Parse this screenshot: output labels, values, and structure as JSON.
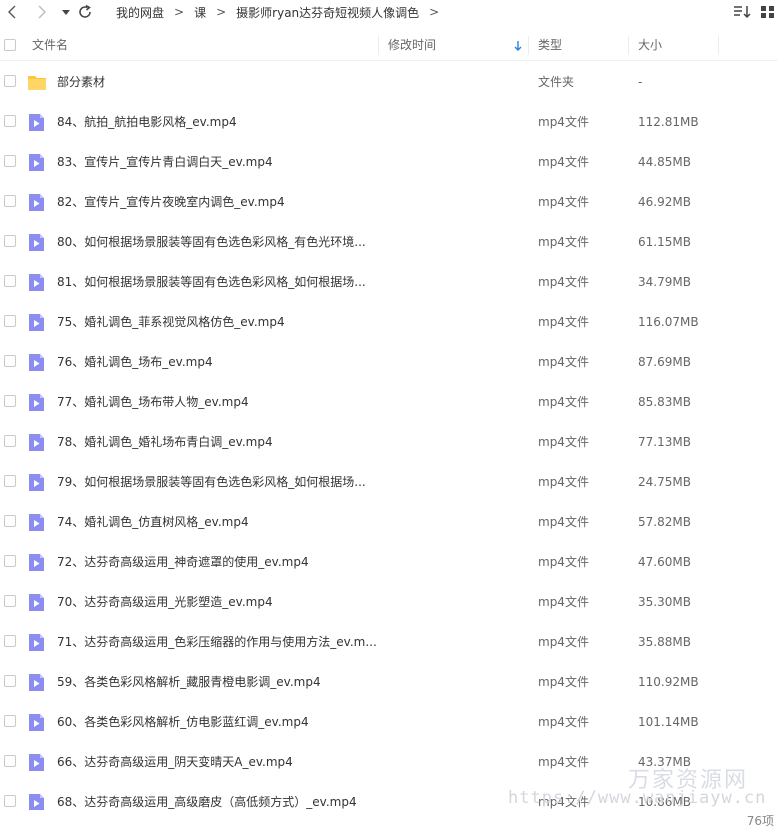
{
  "breadcrumbs": [
    "我的网盘",
    "课",
    "摄影师ryan达芬奇短视频人像调色"
  ],
  "columns": {
    "name": "文件名",
    "modified": "修改时间",
    "type": "类型",
    "size": "大小"
  },
  "files": [
    {
      "name": "部分素材",
      "type": "文件夹",
      "size": "-",
      "icon": "folder-icon"
    },
    {
      "name": "84、航拍_航拍电影风格_ev.mp4",
      "type": "mp4文件",
      "size": "112.81MB",
      "icon": "video-file-icon"
    },
    {
      "name": "83、宣传片_宣传片青白调白天_ev.mp4",
      "type": "mp4文件",
      "size": "44.85MB",
      "icon": "video-file-icon"
    },
    {
      "name": "82、宣传片_宣传片夜晚室内调色_ev.mp4",
      "type": "mp4文件",
      "size": "46.92MB",
      "icon": "video-file-icon"
    },
    {
      "name": "80、如何根据场景服装等固有色选色彩风格_有色光环境...",
      "type": "mp4文件",
      "size": "61.15MB",
      "icon": "video-file-icon"
    },
    {
      "name": "81、如何根据场景服装等固有色选色彩风格_如何根据场...",
      "type": "mp4文件",
      "size": "34.79MB",
      "icon": "video-file-icon"
    },
    {
      "name": "75、婚礼调色_菲系视觉风格仿色_ev.mp4",
      "type": "mp4文件",
      "size": "116.07MB",
      "icon": "video-file-icon"
    },
    {
      "name": "76、婚礼调色_场布_ev.mp4",
      "type": "mp4文件",
      "size": "87.69MB",
      "icon": "video-file-icon"
    },
    {
      "name": "77、婚礼调色_场布带人物_ev.mp4",
      "type": "mp4文件",
      "size": "85.83MB",
      "icon": "video-file-icon"
    },
    {
      "name": "78、婚礼调色_婚礼场布青白调_ev.mp4",
      "type": "mp4文件",
      "size": "77.13MB",
      "icon": "video-file-icon"
    },
    {
      "name": "79、如何根据场景服装等固有色选色彩风格_如何根据场...",
      "type": "mp4文件",
      "size": "24.75MB",
      "icon": "video-file-icon"
    },
    {
      "name": "74、婚礼调色_仿直树风格_ev.mp4",
      "type": "mp4文件",
      "size": "57.82MB",
      "icon": "video-file-icon"
    },
    {
      "name": "72、达芬奇高级运用_神奇遮罩的使用_ev.mp4",
      "type": "mp4文件",
      "size": "47.60MB",
      "icon": "video-file-icon"
    },
    {
      "name": "70、达芬奇高级运用_光影塑造_ev.mp4",
      "type": "mp4文件",
      "size": "35.30MB",
      "icon": "video-file-icon"
    },
    {
      "name": "71、达芬奇高级运用_色彩压缩器的作用与使用方法_ev.m...",
      "type": "mp4文件",
      "size": "35.88MB",
      "icon": "video-file-icon"
    },
    {
      "name": "59、各类色彩风格解析_藏服青橙电影调_ev.mp4",
      "type": "mp4文件",
      "size": "110.92MB",
      "icon": "video-file-icon"
    },
    {
      "name": "60、各类色彩风格解析_仿电影蓝红调_ev.mp4",
      "type": "mp4文件",
      "size": "101.14MB",
      "icon": "video-file-icon"
    },
    {
      "name": "66、达芬奇高级运用_阴天变晴天A_ev.mp4",
      "type": "mp4文件",
      "size": "43.37MB",
      "icon": "video-file-icon"
    },
    {
      "name": "68、达芬奇高级运用_高级磨皮（高低频方式）_ev.mp4",
      "type": "mp4文件",
      "size": "10.86MB",
      "icon": "video-file-icon"
    }
  ],
  "item_count": "76项",
  "watermark": {
    "brand": "万家资源网",
    "url": "https://www.wanjiayw.cn"
  },
  "colors": {
    "folder": "#ffc53d",
    "video": "#8b8ef0",
    "sort_arrow": "#2f7fe0"
  }
}
